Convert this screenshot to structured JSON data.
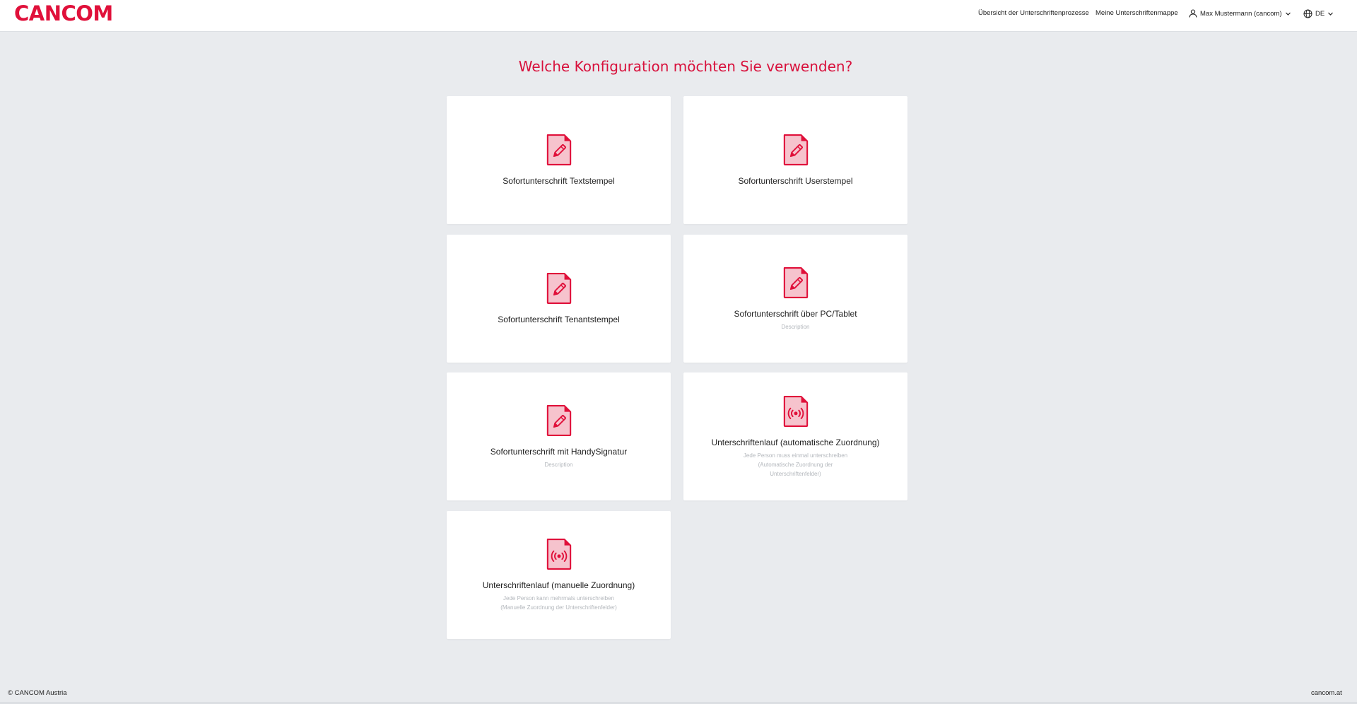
{
  "header": {
    "logo": "CANCOM",
    "nav": {
      "overview": "Übersicht der Unterschriftenprozesse",
      "folder": "Meine Unterschriftenmappe",
      "user": "Max Mustermann (cancom)",
      "lang": "DE"
    },
    "icons": {
      "user": "user-icon",
      "globe": "globe-icon",
      "chevron": "chevron-down-icon"
    }
  },
  "main": {
    "title": "Welche Konfiguration möchten Sie verwenden?",
    "cards": [
      {
        "title": "Sofortunterschrift Textstempel",
        "description": "",
        "icon": "document-pen-icon"
      },
      {
        "title": "Sofortunterschrift Userstempel",
        "description": "",
        "icon": "document-pen-icon"
      },
      {
        "title": "Sofortunterschrift Tenantstempel",
        "description": "",
        "icon": "document-pen-icon"
      },
      {
        "title": "Sofortunterschrift über PC/Tablet",
        "description": "Description",
        "icon": "document-pen-icon"
      },
      {
        "title": "Sofortunterschrift mit HandySignatur",
        "description": "Description",
        "icon": "document-pen-icon"
      },
      {
        "title": "Unterschriftenlauf (automatische Zuordnung)",
        "description": "Jede Person muss einmal unterschreiben\n(Automatische Zuordnung der\nUnterschriftenfelder)",
        "icon": "document-broadcast-icon"
      },
      {
        "title": "Unterschriftenlauf (manuelle Zuordnung)",
        "description": "Jede Person kann mehrmals unterschreiben\n(Manuelle Zuordnung der Unterschriftenfelder)",
        "icon": "document-broadcast-icon"
      }
    ]
  },
  "footer": {
    "copyright": "© CANCOM Austria",
    "link": "cancom.at"
  },
  "colors": {
    "brand": "#e0103a",
    "icon_fill": "#f6c3cd",
    "background": "#e9ebee",
    "card": "#ffffff",
    "muted": "#b3b7bc"
  }
}
